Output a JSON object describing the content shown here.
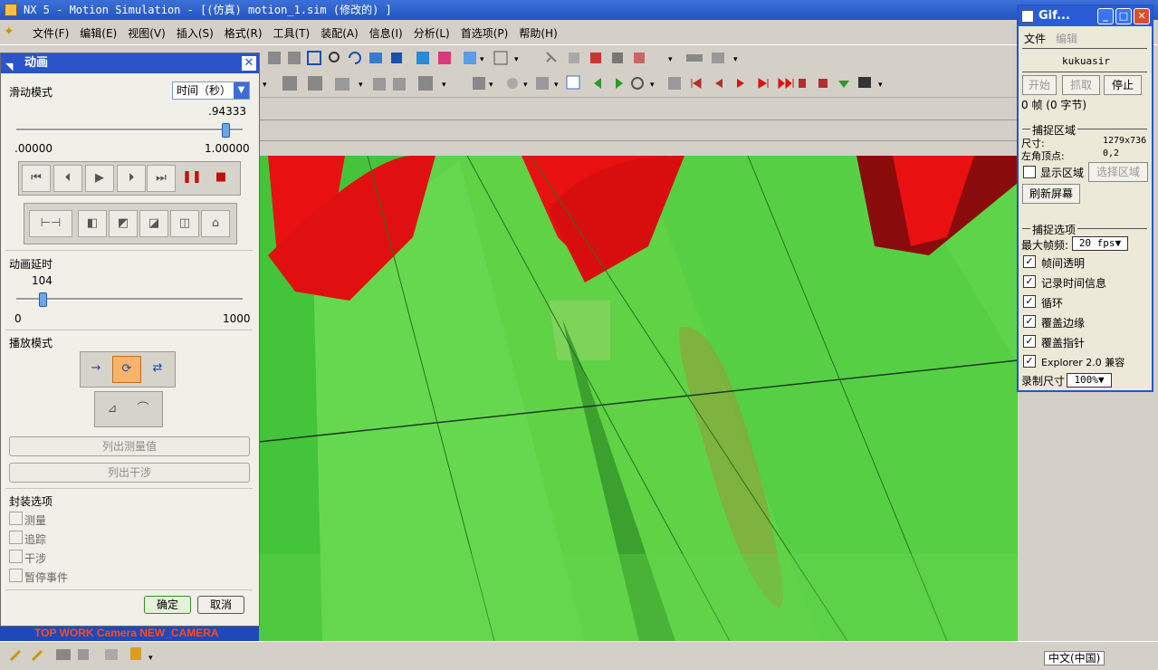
{
  "app": {
    "title": "NX 5 - Motion Simulation - [(仿真) motion_1.sim (修改的) ]"
  },
  "menu": [
    "文件(F)",
    "编辑(E)",
    "视图(V)",
    "插入(S)",
    "格式(R)",
    "工具(T)",
    "装配(A)",
    "信息(I)",
    "分析(L)",
    "首选项(P)",
    "帮助(H)"
  ],
  "dialog": {
    "title": "动画",
    "slide_mode_label": "滑动模式",
    "slide_mode_value": "时间（秒）",
    "time_value": ".94333",
    "time_min": ".00000",
    "time_max": "1.00000",
    "time_fraction": 0.94333,
    "delay_label": "动画延时",
    "delay_value": "104",
    "delay_min": "0",
    "delay_max": "1000",
    "delay_fraction": 0.104,
    "play_mode_label": "播放模式",
    "list_measure_label": "列出测量值",
    "list_interference_label": "列出干涉",
    "package_label": "封装选项",
    "package_options": [
      "测量",
      "追踪",
      "干涉",
      "暂停事件"
    ],
    "ok_label": "确定",
    "cancel_label": "取消"
  },
  "viewport": {
    "camera_text": "TOP WORK Camera NEW_CAMERA"
  },
  "gif": {
    "title": "Gif...",
    "menu_file": "文件",
    "menu_edit": "编辑",
    "user": "kukuasir",
    "start_label": "开始",
    "grab_label": "抓取",
    "stop_label": "停止",
    "frames_text": "0 帧 (0 字节)",
    "capture_area_label": "捕捉区域",
    "size_label": "尺寸:",
    "size_value": "1279x736",
    "corner_label": "左角顶点:",
    "corner_value": "0,2",
    "show_area_label": "显示区域",
    "select_area_label": "选择区域",
    "refresh_label": "刷新屏幕",
    "capture_options_label": "捕捉选项",
    "max_fps_label": "最大帧频:",
    "max_fps_value": "20 fps",
    "options": [
      "帧间透明",
      "记录时间信息",
      "循环",
      "覆盖边缘",
      "覆盖指针",
      "Explorer 2.0 兼容"
    ],
    "record_size_label": "录制尺寸",
    "record_size_value": "100%"
  },
  "taskbar": {
    "ime_text": "中文(中国)"
  },
  "colors": {
    "titlebar": "#2456c4",
    "model_green": "#63d94a",
    "model_red": "#e81010",
    "dark_red": "#8a0b0b",
    "camera_text": "#ff4a1a"
  }
}
